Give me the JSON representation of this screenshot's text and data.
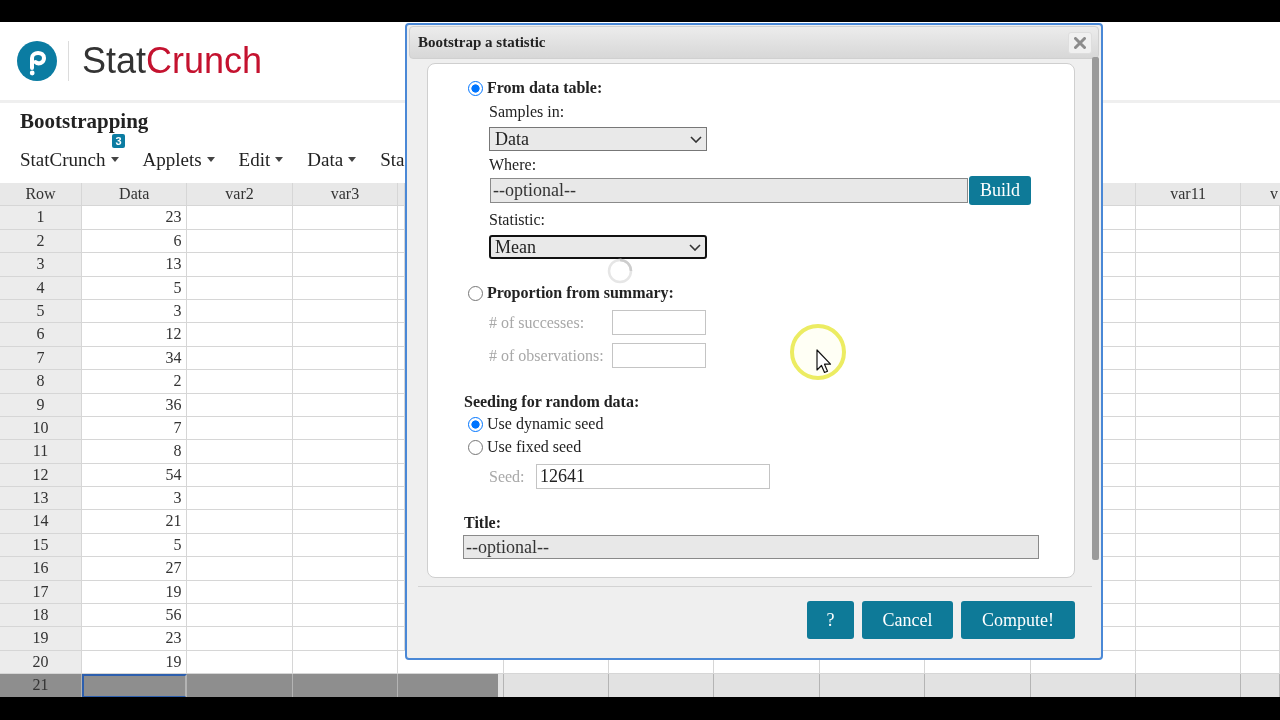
{
  "brand": {
    "name_dark": "Stat",
    "name_accent": "Crunch"
  },
  "page_title": "Bootstrapping",
  "menu": [
    {
      "label": "StatCrunch",
      "dropdown": true,
      "badge": "3"
    },
    {
      "label": "Applets",
      "dropdown": true
    },
    {
      "label": "Edit",
      "dropdown": true
    },
    {
      "label": "Data",
      "dropdown": true
    },
    {
      "label": "Sta",
      "dropdown": false
    }
  ],
  "grid": {
    "columns_left": [
      "Row",
      "Data",
      "var2",
      "var3"
    ],
    "columns_right": [
      "var11",
      "v"
    ],
    "rows": [
      {
        "row": "1",
        "value": "23",
        "selected": false
      },
      {
        "row": "2",
        "value": "6",
        "selected": false
      },
      {
        "row": "3",
        "value": "13",
        "selected": false
      },
      {
        "row": "4",
        "value": "5",
        "selected": false
      },
      {
        "row": "5",
        "value": "3",
        "selected": false
      },
      {
        "row": "6",
        "value": "12",
        "selected": false
      },
      {
        "row": "7",
        "value": "34",
        "selected": false
      },
      {
        "row": "8",
        "value": "2",
        "selected": false
      },
      {
        "row": "9",
        "value": "36",
        "selected": false
      },
      {
        "row": "10",
        "value": "7",
        "selected": false
      },
      {
        "row": "11",
        "value": "8",
        "selected": false
      },
      {
        "row": "12",
        "value": "54",
        "selected": false
      },
      {
        "row": "13",
        "value": "3",
        "selected": false
      },
      {
        "row": "14",
        "value": "21",
        "selected": false
      },
      {
        "row": "15",
        "value": "5",
        "selected": false
      },
      {
        "row": "16",
        "value": "27",
        "selected": false
      },
      {
        "row": "17",
        "value": "19",
        "selected": false
      },
      {
        "row": "18",
        "value": "56",
        "selected": false
      },
      {
        "row": "19",
        "value": "23",
        "selected": false
      },
      {
        "row": "20",
        "value": "19",
        "selected": false
      },
      {
        "row": "21",
        "selected": true
      }
    ]
  },
  "dialog": {
    "title": "Bootstrap a statistic",
    "from_table": {
      "label": "From data table:",
      "selected": true,
      "samples": {
        "label": "Samples in:",
        "value": "Data",
        "focused": false
      },
      "where": {
        "label": "Where:",
        "placeholder": "--optional--",
        "button": "Build"
      },
      "statistic": {
        "label": "Statistic:",
        "value": "Mean",
        "focused": true
      }
    },
    "from_summary": {
      "label": "Proportion from summary:",
      "selected": false,
      "disabled": true,
      "fields": [
        {
          "label": "# of successes:"
        },
        {
          "label": "# of observations:"
        }
      ]
    },
    "seeding": {
      "label": "Seeding for random data:",
      "options": [
        {
          "label": "Use dynamic seed",
          "selected": true
        },
        {
          "label": "Use fixed seed",
          "selected": false
        }
      ],
      "seed": {
        "label": "Seed:",
        "value": "12641",
        "disabled": true
      }
    },
    "title_field": {
      "label": "Title:",
      "placeholder": "--optional--"
    },
    "buttons": [
      "?",
      "Cancel",
      "Compute!"
    ]
  }
}
